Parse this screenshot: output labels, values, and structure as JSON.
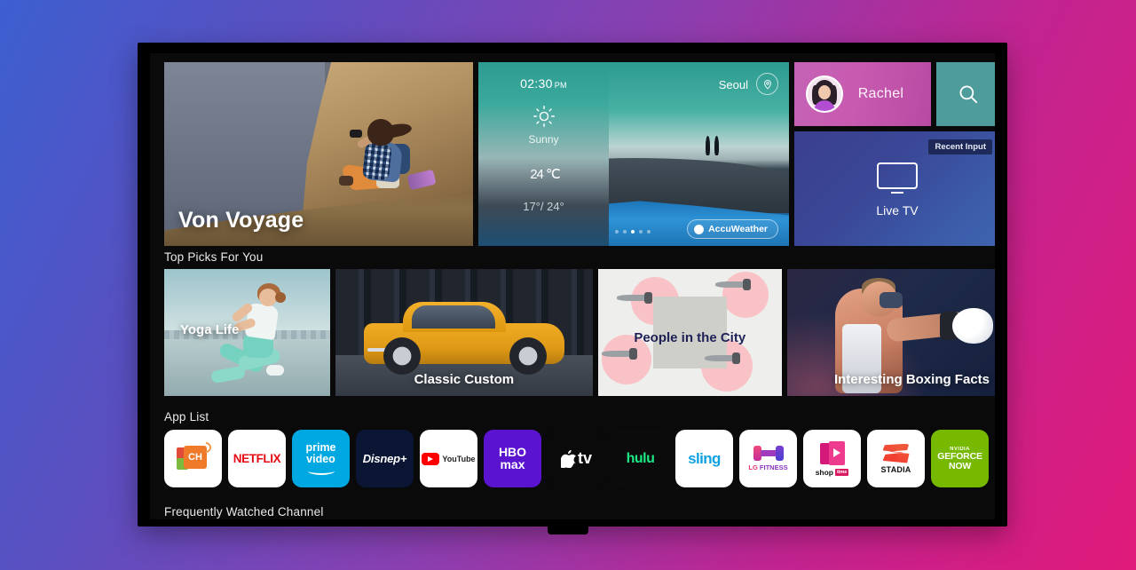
{
  "device": {
    "name": "lg-smart-tv",
    "screen_label": "webOS Home"
  },
  "hero": {
    "title": "Von Voyage",
    "image_desc": "woman-with-binoculars-on-cliff"
  },
  "weather": {
    "time": "02:30",
    "meridiem": "PM",
    "condition": "Sunny",
    "temperature": "24",
    "unit": "℃",
    "range": "17°/ 24°",
    "city": "Seoul",
    "provider": "AccuWeather",
    "pagination": {
      "count": 5,
      "active_index": 2
    },
    "icons": {
      "location": "location-pin-icon",
      "condition": "sun-icon"
    }
  },
  "profile": {
    "name": "Rachel",
    "avatar_icon": "user-avatar-icon",
    "tile_color": "#c85ab0"
  },
  "search": {
    "icon": "search-icon",
    "tile_color": "#4e9c9c"
  },
  "live_tv": {
    "label": "Live TV",
    "badge": "Recent Input",
    "icon": "television-icon",
    "tile_color": "#3b4a9e"
  },
  "sections": {
    "top_picks_title": "Top Picks For You",
    "app_list_title": "App List",
    "frequently_watched_title": "Frequently Watched Channel"
  },
  "top_picks": [
    {
      "title": "Yoga Life",
      "image_desc": "woman-running-by-river"
    },
    {
      "title": "Classic Custom",
      "image_desc": "yellow-classic-coupe-car"
    },
    {
      "title": "People in the City",
      "image_desc": "illustration-people-pink-dots"
    },
    {
      "title": "Interesting Boxing Facts",
      "image_desc": "boxer-punching"
    }
  ],
  "apps": [
    {
      "name": "CH",
      "icon": "channels-app-icon",
      "bg": "#ffffff"
    },
    {
      "name": "NETFLIX",
      "icon": "netflix-icon",
      "bg": "#ffffff"
    },
    {
      "name": "prime video",
      "icon": "prime-video-icon",
      "bg": "#00a8e1"
    },
    {
      "name": "Disney+",
      "icon": "disney-plus-icon",
      "bg": "#0b1634"
    },
    {
      "name": "YouTube",
      "icon": "youtube-icon",
      "bg": "#ffffff"
    },
    {
      "name": "HBO max",
      "icon": "hbo-max-icon",
      "bg": "#5a14d0"
    },
    {
      "name": "tv",
      "icon": "apple-tv-icon",
      "bg": "#0a0a0a"
    },
    {
      "name": "hulu",
      "icon": "hulu-icon",
      "bg": "#0b0b0b"
    },
    {
      "name": "sling",
      "icon": "sling-tv-icon",
      "bg": "#ffffff"
    },
    {
      "name": "LG FITNESS",
      "icon": "lg-fitness-icon",
      "bg": "#ffffff"
    },
    {
      "name": "shop",
      "icon": "shoptime-icon",
      "bg": "#ffffff"
    },
    {
      "name": "STADIA",
      "icon": "stadia-icon",
      "bg": "#ffffff"
    },
    {
      "name": "GEFORCE NOW",
      "icon": "geforce-now-icon",
      "bg": "#76b900"
    },
    {
      "name": "",
      "icon": "partial-app-icon",
      "bg": "#ffffff"
    }
  ],
  "app_text": {
    "netflix": "NETFLIX",
    "prime_line1": "prime",
    "prime_line2": "video",
    "disney": "Disnep+",
    "youtube": "YouTube",
    "hbo_line1": "HBO",
    "hbo_line2": "max",
    "appletv": "tv",
    "hulu": "hulu",
    "sling": "sling",
    "lg_fitness_a": "LG",
    "lg_fitness_b": "FITNESS",
    "shop": "shop",
    "shop_badge": "time",
    "stadia": "STADIA",
    "gfn_brand": "NVIDIA",
    "gfn_line1": "GEFORCE",
    "gfn_line2": "NOW",
    "ch": "CH"
  },
  "colors": {
    "background_start": "#3d5fd0",
    "background_end": "#e01a7a",
    "screen_bg": "#0a0a0a",
    "accent_teal": "#4e9c9c",
    "accent_pink": "#c85ab0"
  }
}
